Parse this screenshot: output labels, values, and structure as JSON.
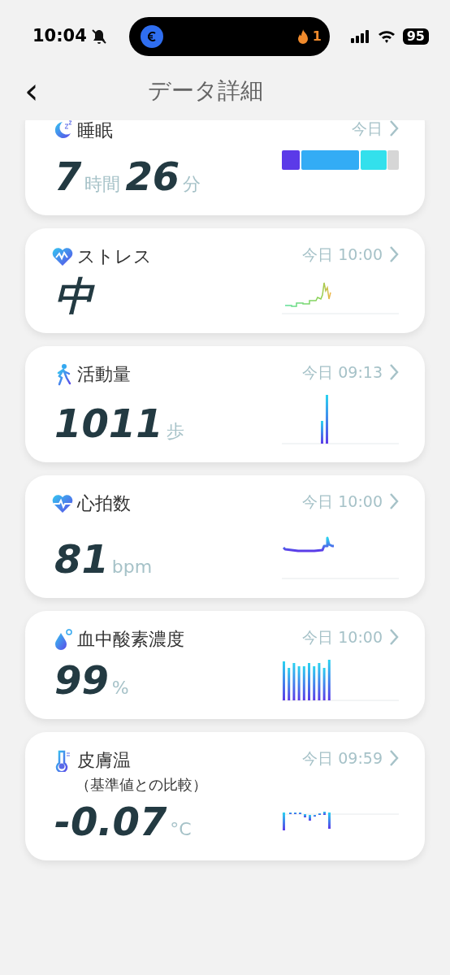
{
  "status_bar": {
    "time": "10:04",
    "island_count": "1",
    "battery": "95"
  },
  "header": {
    "back": "‹",
    "title": "データ詳細"
  },
  "metrics": [
    {
      "kind": "sleep",
      "title": "睡眠",
      "time": "今日",
      "value_parts": [
        {
          "text": "7",
          "kind": "number"
        },
        {
          "text": "時間",
          "kind": "unit"
        },
        {
          "text": "26",
          "kind": "number"
        },
        {
          "text": "分",
          "kind": "unit"
        }
      ]
    },
    {
      "kind": "stress",
      "title": "ストレス",
      "time": "今日 10:00",
      "value_parts": [
        {
          "text": "中",
          "kind": "number"
        }
      ]
    },
    {
      "kind": "steps",
      "title": "活動量",
      "time": "今日 09:13",
      "value_parts": [
        {
          "text": "1011",
          "kind": "number"
        },
        {
          "text": "歩",
          "kind": "unit"
        }
      ]
    },
    {
      "kind": "heart",
      "title": "心拍数",
      "time": "今日 10:00",
      "value_parts": [
        {
          "text": "81",
          "kind": "number"
        },
        {
          "text": "bpm",
          "kind": "unit"
        }
      ]
    },
    {
      "kind": "spo2",
      "title": "血中酸素濃度",
      "time": "今日 10:00",
      "value_parts": [
        {
          "text": "99",
          "kind": "number"
        },
        {
          "text": "%",
          "kind": "unit"
        }
      ]
    },
    {
      "kind": "temp",
      "title": "皮膚温",
      "subtitle": "（基準値との比較）",
      "time": "今日 09:59",
      "value_parts": [
        {
          "text": "-0.07",
          "kind": "number"
        },
        {
          "text": "°C",
          "kind": "unit"
        }
      ]
    }
  ]
}
